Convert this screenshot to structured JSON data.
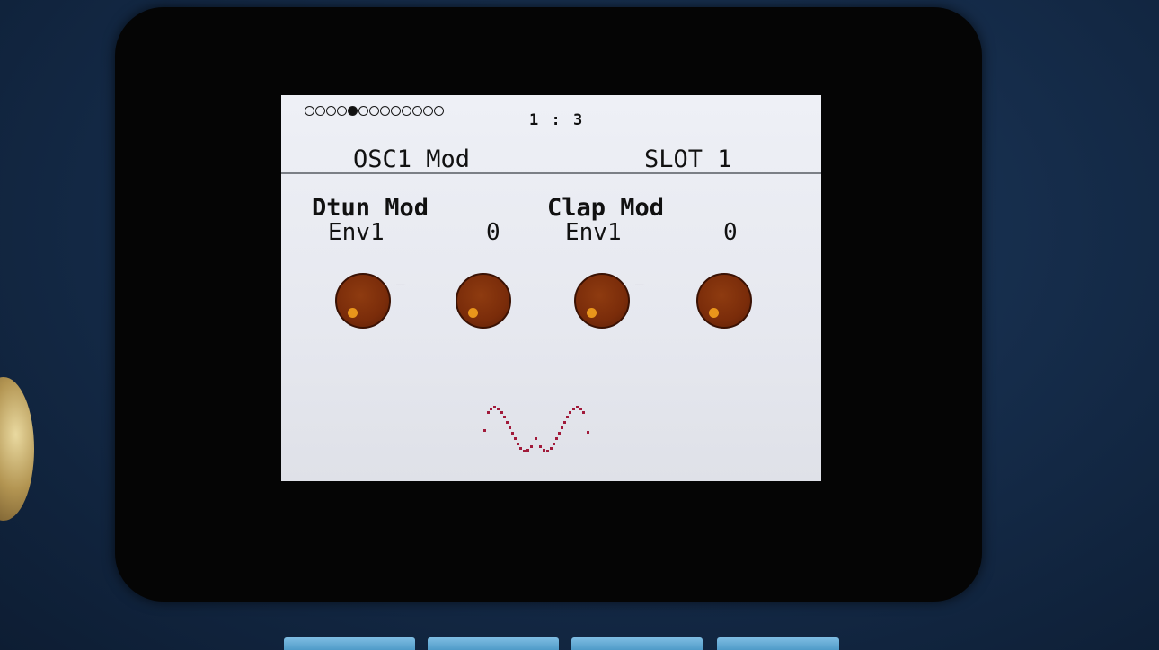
{
  "header": {
    "position": "1 : 3",
    "page_title": "OSC1 Mod",
    "slot": "SLOT 1",
    "page_dots": {
      "total": 13,
      "active_index": 4
    }
  },
  "params": [
    {
      "name": "Dtun Mod",
      "source": "Env1",
      "value": "0"
    },
    {
      "name": "Clap Mod",
      "source": "Env1",
      "value": "0"
    }
  ],
  "knobs": [
    {
      "id": "knob-1",
      "has_minus_mark": true
    },
    {
      "id": "knob-2",
      "has_minus_mark": false
    },
    {
      "id": "knob-3",
      "has_minus_mark": true
    },
    {
      "id": "knob-4",
      "has_minus_mark": false
    }
  ],
  "waveform": {
    "shape": "lfo-sine",
    "color": "#a11a3a"
  },
  "colors": {
    "screen_bg": "#eef0f6",
    "knob": "#7a2c0a",
    "knob_indicator": "#e9961b"
  }
}
